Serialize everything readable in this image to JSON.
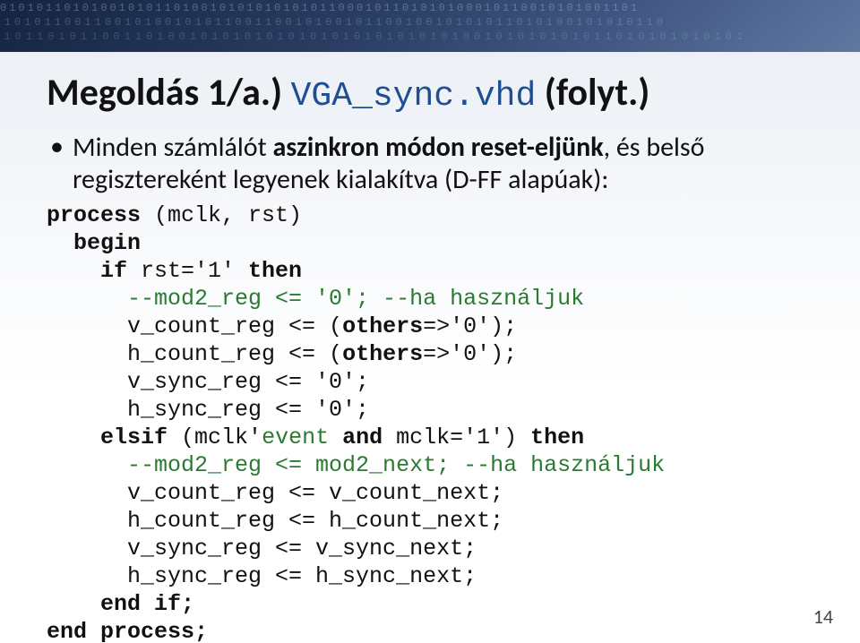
{
  "title": {
    "part1": "Megoldás 1/a.) ",
    "filename": "VGA_sync.vhd",
    "part2": " (folyt.)"
  },
  "bullet": {
    "prefix": "Minden számlálót ",
    "bold1": "aszinkron módon reset-eljünk",
    "mid": ", és belső regisztereként legyenek kialakítva (D-FF alapúak):"
  },
  "code": {
    "l01a": "process",
    "l01b": " (mclk, rst)",
    "l02": "  begin",
    "l03a": "    if",
    "l03b": " rst='1' ",
    "l03c": "then",
    "l04a": "      --mod2_reg <= '0'; --ha használjuk",
    "l05a": "      v_count_reg <= (",
    "l05b": "others",
    "l05c": "=>'0');",
    "l06a": "      h_count_reg <= (",
    "l06b": "others",
    "l06c": "=>'0');",
    "l07": "      v_sync_reg <= '0';",
    "l08": "      h_sync_reg <= '0';",
    "l09a": "    elsif",
    "l09b": " (mclk'",
    "l09c": "event ",
    "l09d": "and",
    "l09e": " mclk='1') ",
    "l09f": "then",
    "l10": "      --mod2_reg <= mod2_next; --ha használjuk",
    "l11": "      v_count_reg <= v_count_next;",
    "l12": "      h_count_reg <= h_count_next;",
    "l13": "      v_sync_reg <= v_sync_next;",
    "l14": "      h_sync_reg <= h_sync_next;",
    "l15": "    end if;",
    "l16": "end process;"
  },
  "page_number": "14"
}
